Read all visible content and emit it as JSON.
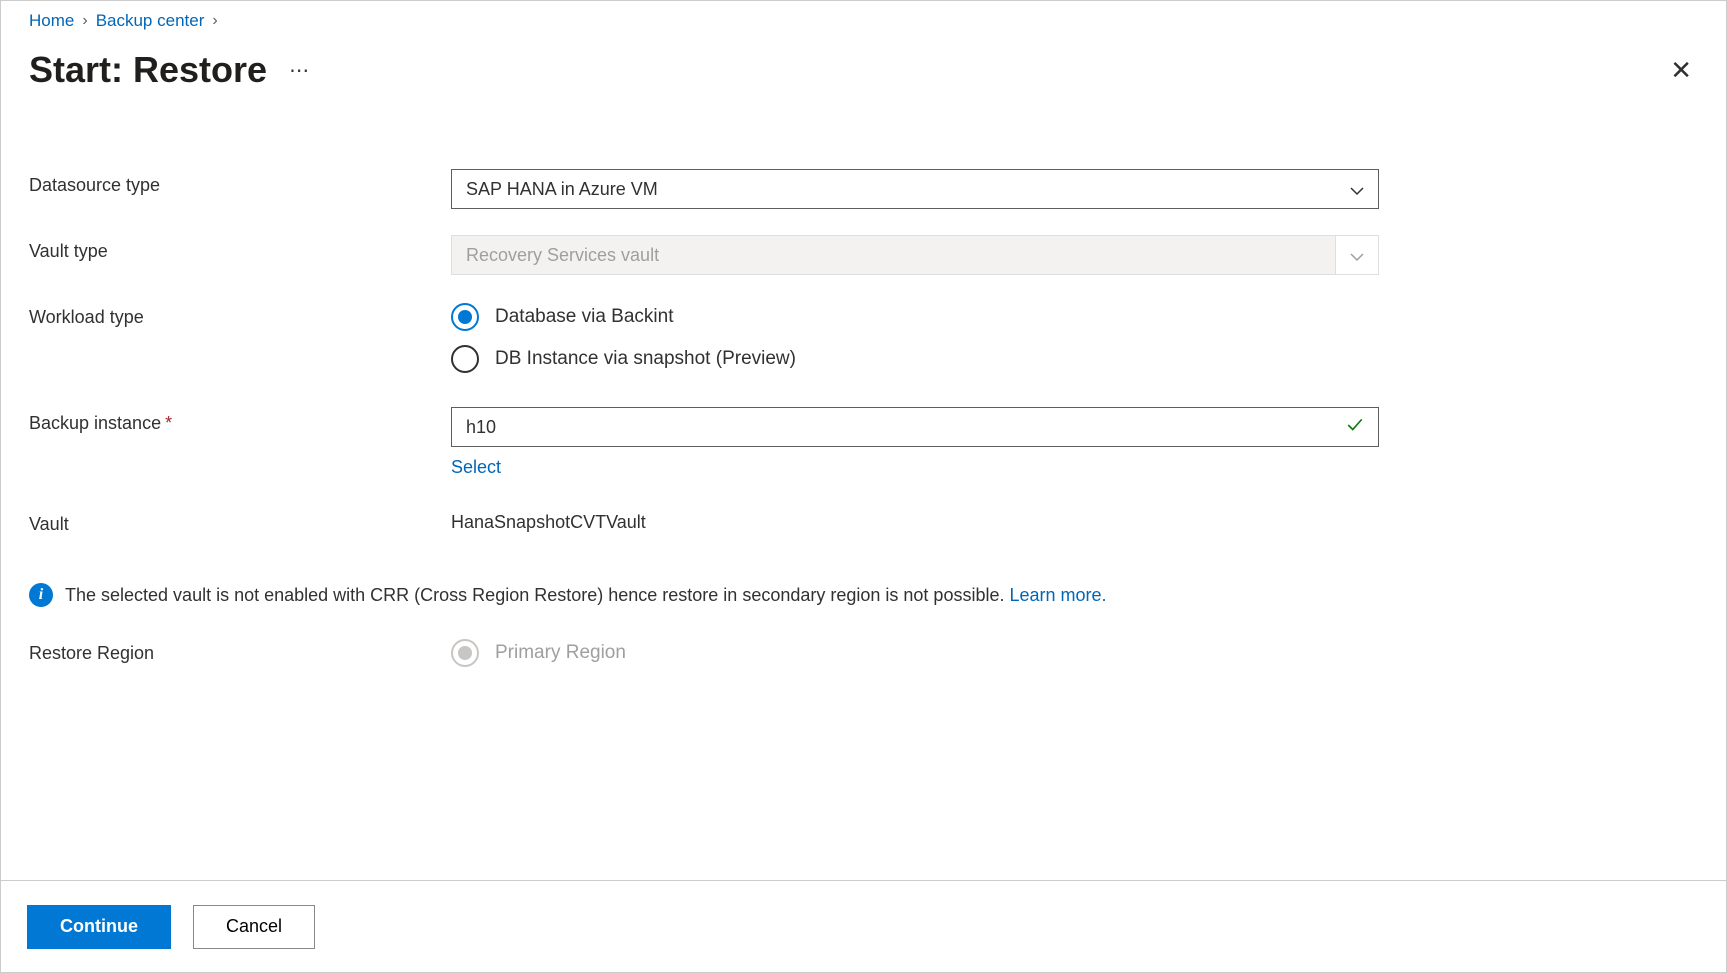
{
  "breadcrumb": {
    "home": "Home",
    "backup_center": "Backup center"
  },
  "title": "Start: Restore",
  "labels": {
    "datasource_type": "Datasource type",
    "vault_type": "Vault type",
    "workload_type": "Workload type",
    "backup_instance": "Backup instance",
    "vault": "Vault",
    "restore_region": "Restore Region"
  },
  "values": {
    "datasource_type": "SAP HANA in Azure VM",
    "vault_type": "Recovery Services vault",
    "backup_instance": "h10",
    "vault": "HanaSnapshotCVTVault"
  },
  "workload_options": {
    "backint": "Database via Backint",
    "snapshot": "DB Instance via snapshot (Preview)"
  },
  "restore_region_options": {
    "primary": "Primary Region"
  },
  "select_link": "Select",
  "info": {
    "text": "The selected vault is not enabled with CRR (Cross Region Restore) hence restore in secondary region is not possible. ",
    "learn_more": "Learn more."
  },
  "buttons": {
    "continue": "Continue",
    "cancel": "Cancel"
  }
}
